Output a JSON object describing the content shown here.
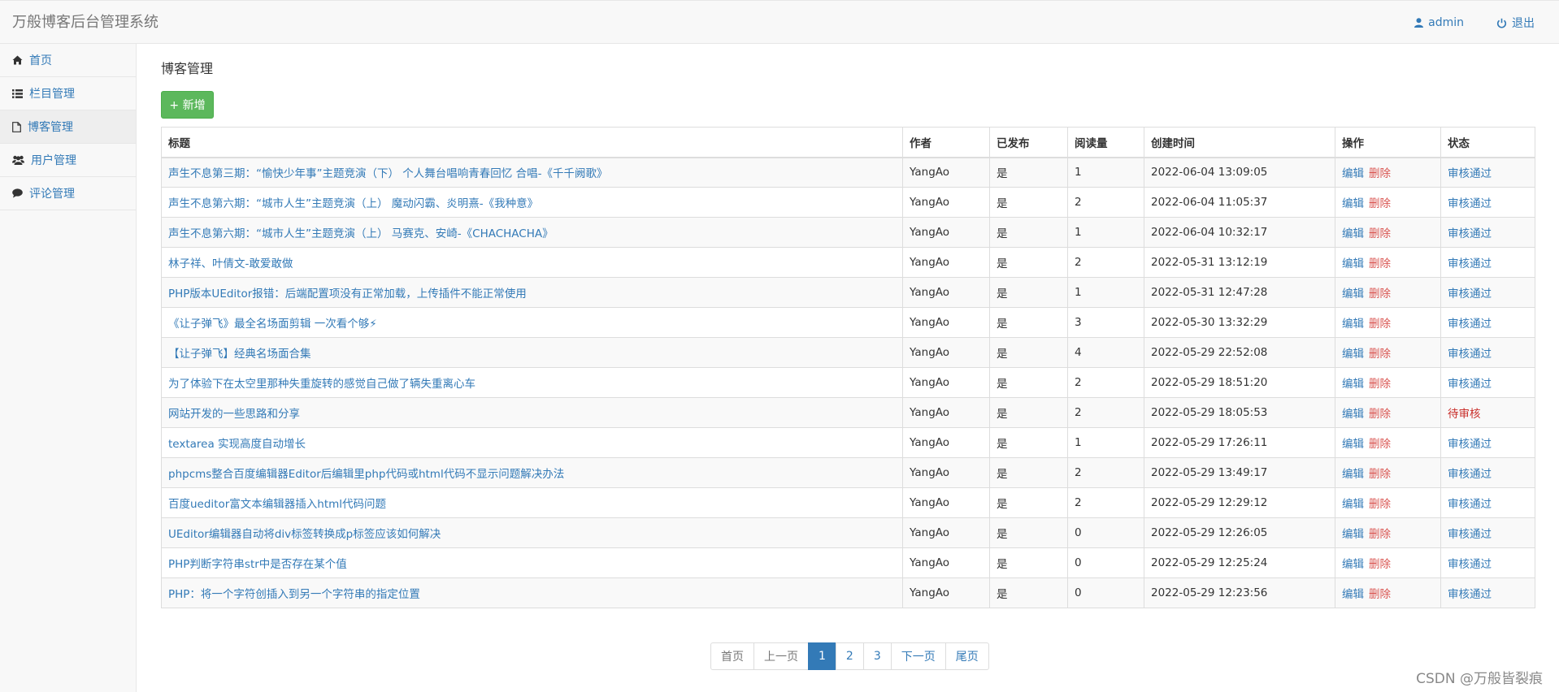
{
  "app": {
    "title": "万般博客后台管理系统",
    "user_label": "admin",
    "logout_label": "退出"
  },
  "sidebar": {
    "items": [
      {
        "label": "首页",
        "icon": "home-icon"
      },
      {
        "label": "栏目管理",
        "icon": "list-icon"
      },
      {
        "label": "博客管理",
        "icon": "file-icon"
      },
      {
        "label": "用户管理",
        "icon": "users-icon"
      },
      {
        "label": "评论管理",
        "icon": "comment-icon"
      }
    ],
    "active_index": 2
  },
  "main": {
    "heading": "博客管理",
    "add_button": "+ 新增",
    "columns": [
      "标题",
      "作者",
      "已发布",
      "阅读量",
      "创建时间",
      "操作",
      "状态"
    ],
    "edit_label": "编辑",
    "delete_label": "删除",
    "rows": [
      {
        "title": "声生不息第三期：“愉快少年事”主题竞演（下） 个人舞台唱响青春回忆 合唱-《千千阙歌》",
        "author": "YangAo",
        "published": "是",
        "views": "1",
        "created": "2022-06-04 13:09:05",
        "status": "审核通过"
      },
      {
        "title": "声生不息第六期：“城市人生”主题竞演（上） 魔动闪霸、炎明熹-《我种意》",
        "author": "YangAo",
        "published": "是",
        "views": "2",
        "created": "2022-06-04 11:05:37",
        "status": "审核通过"
      },
      {
        "title": "声生不息第六期：“城市人生”主题竞演（上） 马赛克、安崎-《CHACHACHA》",
        "author": "YangAo",
        "published": "是",
        "views": "1",
        "created": "2022-06-04 10:32:17",
        "status": "审核通过"
      },
      {
        "title": "林子祥、叶倩文-敢爱敢做",
        "author": "YangAo",
        "published": "是",
        "views": "2",
        "created": "2022-05-31 13:12:19",
        "status": "审核通过"
      },
      {
        "title": "PHP版本UEditor报错：后端配置项没有正常加载，上传插件不能正常使用",
        "author": "YangAo",
        "published": "是",
        "views": "1",
        "created": "2022-05-31 12:47:28",
        "status": "审核通过"
      },
      {
        "title": "《让子弹飞》最全名场面剪辑 一次看个够⚡",
        "author": "YangAo",
        "published": "是",
        "views": "3",
        "created": "2022-05-30 13:32:29",
        "status": "审核通过"
      },
      {
        "title": "【让子弹飞】经典名场面合集",
        "author": "YangAo",
        "published": "是",
        "views": "4",
        "created": "2022-05-29 22:52:08",
        "status": "审核通过"
      },
      {
        "title": "为了体验下在太空里那种失重旋转的感觉自己做了辆失重离心车",
        "author": "YangAo",
        "published": "是",
        "views": "2",
        "created": "2022-05-29 18:51:20",
        "status": "审核通过"
      },
      {
        "title": "网站开发的一些思路和分享",
        "author": "YangAo",
        "published": "是",
        "views": "2",
        "created": "2022-05-29 18:05:53",
        "status": "待审核"
      },
      {
        "title": "textarea 实现高度自动增长",
        "author": "YangAo",
        "published": "是",
        "views": "1",
        "created": "2022-05-29 17:26:11",
        "status": "审核通过"
      },
      {
        "title": "phpcms整合百度编辑器Editor后编辑里php代码或html代码不显示问题解决办法",
        "author": "YangAo",
        "published": "是",
        "views": "2",
        "created": "2022-05-29 13:49:17",
        "status": "审核通过"
      },
      {
        "title": "百度ueditor富文本编辑器插入html代码问题",
        "author": "YangAo",
        "published": "是",
        "views": "2",
        "created": "2022-05-29 12:29:12",
        "status": "审核通过"
      },
      {
        "title": "UEditor编辑器自动将div标签转换成p标签应该如何解决",
        "author": "YangAo",
        "published": "是",
        "views": "0",
        "created": "2022-05-29 12:26:05",
        "status": "审核通过"
      },
      {
        "title": "PHP判断字符串str中是否存在某个值",
        "author": "YangAo",
        "published": "是",
        "views": "0",
        "created": "2022-05-29 12:25:24",
        "status": "审核通过"
      },
      {
        "title": "PHP：将一个字符创插入到另一个字符串的指定位置",
        "author": "YangAo",
        "published": "是",
        "views": "0",
        "created": "2022-05-29 12:23:56",
        "status": "审核通过"
      }
    ]
  },
  "pagination": {
    "items": [
      {
        "label": "首页",
        "state": "disabled"
      },
      {
        "label": "上一页",
        "state": "disabled"
      },
      {
        "label": "1",
        "state": "current"
      },
      {
        "label": "2",
        "state": "normal"
      },
      {
        "label": "3",
        "state": "normal"
      },
      {
        "label": "下一页",
        "state": "normal"
      },
      {
        "label": "尾页",
        "state": "normal"
      }
    ]
  },
  "watermark": "CSDN @万般皆裂痕",
  "colors": {
    "link": "#337ab7",
    "danger": "#d9534f",
    "success": "#5cb85c"
  }
}
